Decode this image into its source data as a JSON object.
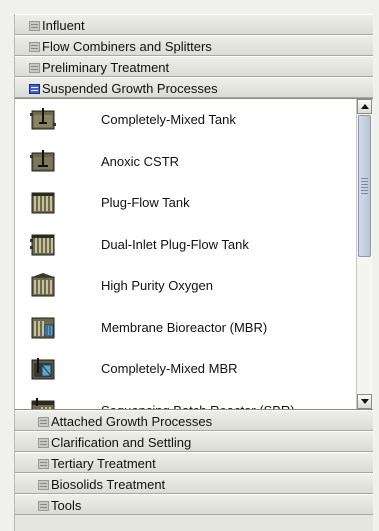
{
  "groups_top": [
    {
      "label": "Influent"
    },
    {
      "label": "Flow Combiners and Splitters"
    },
    {
      "label": "Preliminary Treatment"
    },
    {
      "label": "Suspended Growth Processes"
    }
  ],
  "items": [
    {
      "label": "Completely-Mixed Tank",
      "icon": "completely-mixed-tank-icon"
    },
    {
      "label": "Anoxic CSTR",
      "icon": "anoxic-cstr-icon"
    },
    {
      "label": "Plug-Flow Tank",
      "icon": "plug-flow-tank-icon"
    },
    {
      "label": "Dual-Inlet Plug-Flow Tank",
      "icon": "dual-inlet-plug-flow-tank-icon"
    },
    {
      "label": "High Purity Oxygen",
      "icon": "high-purity-oxygen-icon"
    },
    {
      "label": "Membrane Bioreactor (MBR)",
      "icon": "membrane-bioreactor-icon"
    },
    {
      "label": "Completely-Mixed MBR",
      "icon": "completely-mixed-mbr-icon"
    },
    {
      "label": "Sequencing Batch Reactor (SBR)",
      "icon": "sbr-icon"
    }
  ],
  "groups_bottom": [
    {
      "label": "Attached Growth Processes"
    },
    {
      "label": "Clarification and Settling"
    },
    {
      "label": "Tertiary Treatment"
    },
    {
      "label": "Biosolids Treatment"
    },
    {
      "label": "Tools"
    }
  ],
  "colors": {
    "active_group_icon": "#4b5fc8",
    "panel_bg": "#e6e6e0",
    "list_bg": "#ffffff"
  }
}
